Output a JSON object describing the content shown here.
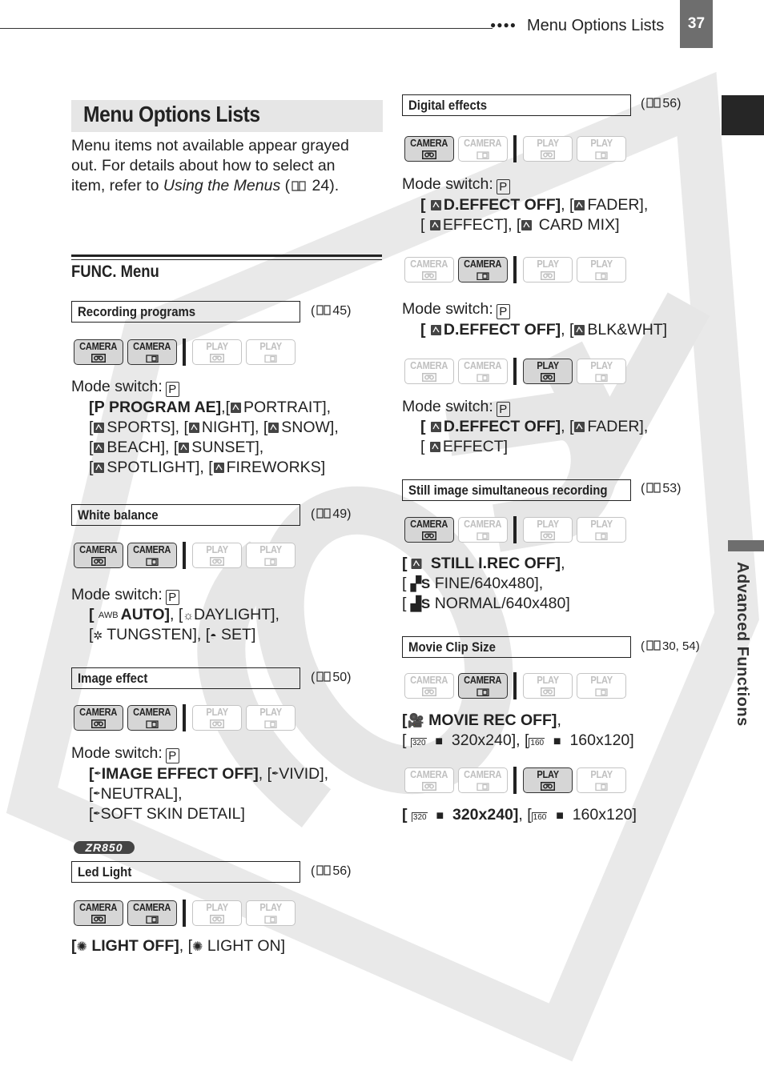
{
  "header": {
    "running_title": "Menu Options Lists",
    "page_number": "37",
    "dots": "●●●●"
  },
  "side_tab": {
    "label": "Advanced Functions"
  },
  "watermark": "COPY",
  "main": {
    "heading": "Menu Options Lists",
    "intro_1": "Menu items not available appear grayed",
    "intro_2": "out. For details about how to select an",
    "intro_3a": "item, refer to ",
    "intro_3b": "Using the Menus",
    "intro_3c": " (",
    "intro_3d": " 24).",
    "func_menu_title": "FUNC. Menu"
  },
  "mode_labels": {
    "camera": "CAMERA",
    "play": "PLAY",
    "mode_switch": "Mode switch:",
    "p": "P"
  },
  "sections": {
    "recording_programs": {
      "title": "Recording programs",
      "ref": "45",
      "modes": [
        true,
        true,
        false,
        false
      ],
      "l1a": "PROGRAM AE]",
      "l1b": ",[",
      "l1c": "PORTRAIT],",
      "l2a": "SPORTS], [",
      "l2b": "NIGHT], [",
      "l2c": "SNOW],",
      "l3a": "BEACH], [",
      "l3b": "SUNSET],",
      "l4a": "SPOTLIGHT], [",
      "l4b": "FIREWORKS]"
    },
    "white_balance": {
      "title": "White balance",
      "ref": "49",
      "modes": [
        true,
        true,
        false,
        false
      ],
      "l1a": "AUTO]",
      "l1b": ", [",
      "l1c": "DAYLIGHT],",
      "l2a": "TUNGSTEN], [",
      "l2b": "SET]"
    },
    "image_effect": {
      "title": "Image effect",
      "ref": "50",
      "modes": [
        true,
        true,
        false,
        false
      ],
      "l1a": "IMAGE EFFECT OFF]",
      "l1b": ", [",
      "l1c": "VIVID],",
      "l2": "NEUTRAL],",
      "l3": "SOFT SKIN DETAIL]"
    },
    "led_light": {
      "badge": "ZR850",
      "title": "Led Light",
      "ref": "56",
      "modes": [
        true,
        true,
        false,
        false
      ],
      "l1a": "LIGHT OFF]",
      "l1b": ", [",
      "l1c": "LIGHT ON]"
    },
    "digital_effects": {
      "title": "Digital effects",
      "ref": "56",
      "groups": [
        {
          "modes": [
            true,
            false,
            false,
            false
          ],
          "l1a": "D.EFFECT OFF]",
          "l1b": ", [",
          "l1c": "FADER],",
          "l2a": "EFFECT], [",
          "l2b": "CARD MIX]"
        },
        {
          "modes": [
            false,
            true,
            false,
            false
          ],
          "l1a": "D.EFFECT OFF]",
          "l1b": ", [",
          "l1c": "BLK&WHT]"
        },
        {
          "modes": [
            false,
            false,
            true,
            false
          ],
          "l1a": "D.EFFECT OFF]",
          "l1b": ", [",
          "l1c": "FADER],",
          "l2a": "EFFECT]"
        }
      ]
    },
    "still_image": {
      "title": "Still image simultaneous recording",
      "ref": "53",
      "modes": [
        true,
        false,
        false,
        false
      ],
      "l1a": "STILL I.REC OFF]",
      "l1b": ",",
      "l2": "FINE/640x480],",
      "l3": "NORMAL/640x480]"
    },
    "movie_clip": {
      "title": "Movie Clip Size",
      "ref": "30, 54",
      "groups": [
        {
          "modes": [
            false,
            true,
            false,
            false
          ],
          "l1a": "MOVIE REC OFF]",
          "l1b": ",",
          "l2a": "320x240], [",
          "l2b": "160x120]"
        },
        {
          "modes": [
            false,
            false,
            true,
            false
          ],
          "l1a": "320x240]",
          "l1b": ", [",
          "l1c": "160x120]"
        }
      ]
    }
  }
}
